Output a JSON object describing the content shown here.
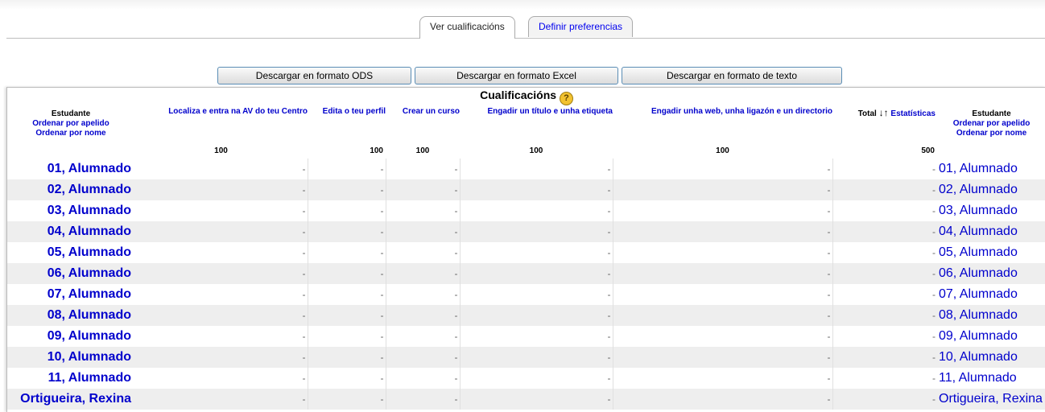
{
  "tabs": [
    {
      "label": "Ver cualificacións",
      "active": true
    },
    {
      "label": "Definir preferencias",
      "active": false
    }
  ],
  "download_buttons": [
    "Descargar en formato ODS",
    "Descargar en formato Excel",
    "Descargar en formato de texto"
  ],
  "report": {
    "title": "Cualificacións",
    "help_icon": "help-icon",
    "student_header": {
      "label": "Estudante",
      "sort_lastname": "Ordenar por apelido",
      "sort_firstname": "Ordenar por nome"
    },
    "columns": [
      {
        "name": "Localiza e entra na AV do teu Centro",
        "points": "100"
      },
      {
        "name": "Edita o teu perfil",
        "points": "100"
      },
      {
        "name": "Crear un curso",
        "points": "100"
      },
      {
        "name": "Engadir un título e unha etiqueta",
        "points": "100"
      },
      {
        "name": "Engadir unha web, unha ligazón e un directorio",
        "points": "100"
      }
    ],
    "total": {
      "label": "Total",
      "sort_icons": "↓↑",
      "stats_link": "Estatísticas",
      "points": "500"
    },
    "empty_grade": "-",
    "students": [
      "01, Alumnado",
      "02, Alumnado",
      "03, Alumnado",
      "04, Alumnado",
      "05, Alumnado",
      "06, Alumnado",
      "07, Alumnado",
      "08, Alumnado",
      "09, Alumnado",
      "10, Alumnado",
      "11, Alumnado",
      "Ortigueira, Rexina"
    ]
  },
  "colors": {
    "link": "#0000cc",
    "alt_row": "#eeeeee",
    "button_border": "#5a8db5"
  }
}
